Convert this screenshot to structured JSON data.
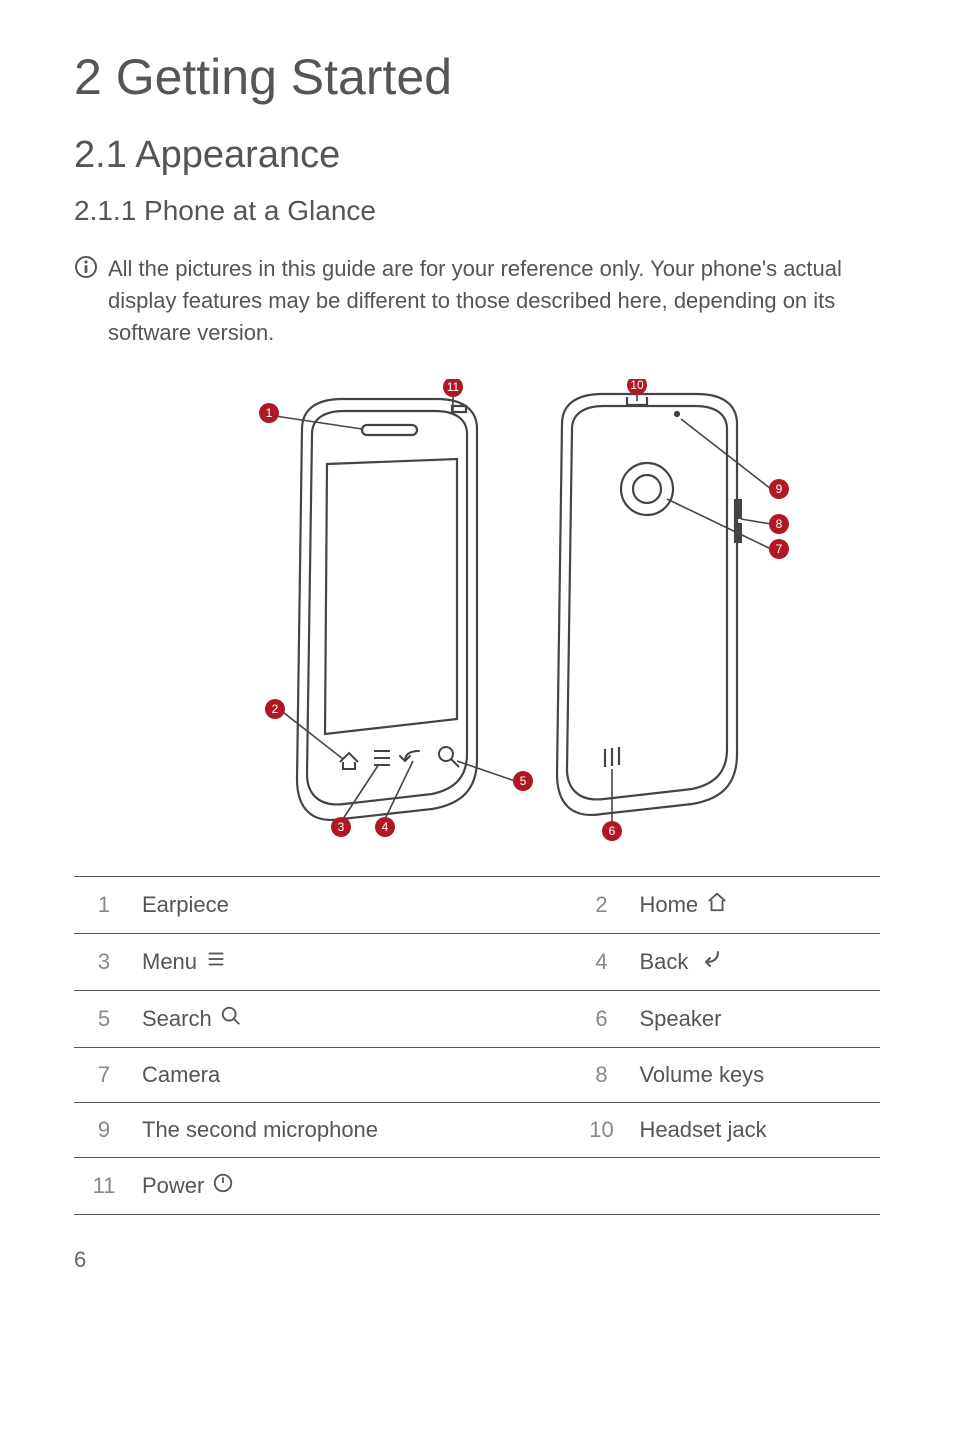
{
  "chapter_title": "2  Getting Started",
  "section_title": "2.1  Appearance",
  "subsection_title": "2.1.1   Phone at a Glance",
  "note_text": "All the pictures in this guide are for your reference only. Your phone's actual display features may be different to those described here, depending on its software version.",
  "diagram": {
    "callouts": [
      "1",
      "2",
      "3",
      "4",
      "5",
      "6",
      "7",
      "8",
      "9",
      "10",
      "11"
    ]
  },
  "parts_table": [
    {
      "n": "1",
      "label": "Earpiece",
      "icon": null
    },
    {
      "n": "2",
      "label": "Home",
      "icon": "home"
    },
    {
      "n": "3",
      "label": "Menu",
      "icon": "menu"
    },
    {
      "n": "4",
      "label": "Back",
      "icon": "back"
    },
    {
      "n": "5",
      "label": "Search",
      "icon": "search"
    },
    {
      "n": "6",
      "label": "Speaker",
      "icon": null
    },
    {
      "n": "7",
      "label": "Camera",
      "icon": null
    },
    {
      "n": "8",
      "label": "Volume keys",
      "icon": null
    },
    {
      "n": "9",
      "label": "The second microphone",
      "icon": null
    },
    {
      "n": "10",
      "label": "Headset jack",
      "icon": null
    },
    {
      "n": "11",
      "label": "Power",
      "icon": "power"
    }
  ],
  "page_number": "6",
  "colors": {
    "badge": "#b01824",
    "stroke": "#444"
  }
}
